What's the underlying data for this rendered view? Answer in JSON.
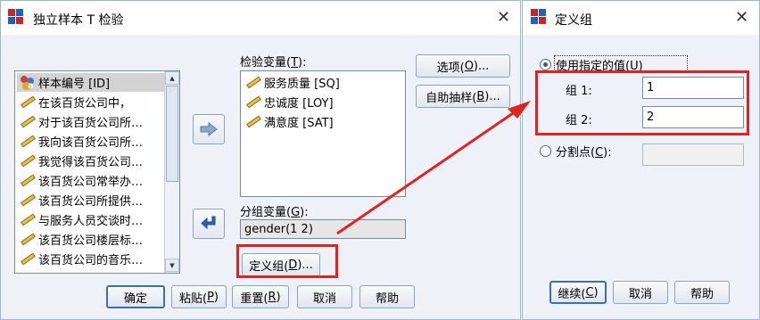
{
  "main_dialog": {
    "title": "独立样本 T 检验",
    "variables": [
      {
        "label": "样本编号 [ID]",
        "icon": "nominal-icon",
        "selected": true
      },
      {
        "label": "在该百货公司中，",
        "icon": "scale-ruler-icon"
      },
      {
        "label": "对于该百货公司所…",
        "icon": "scale-ruler-icon"
      },
      {
        "label": "我向该百货公司所…",
        "icon": "scale-ruler-icon"
      },
      {
        "label": "我觉得该百货公司…",
        "icon": "scale-ruler-icon"
      },
      {
        "label": "该百货公司常举办…",
        "icon": "scale-ruler-icon"
      },
      {
        "label": "该百货公司所提供…",
        "icon": "scale-ruler-icon"
      },
      {
        "label": "与服务人员交谈时…",
        "icon": "scale-ruler-icon"
      },
      {
        "label": "该百货公司楼层标…",
        "icon": "scale-ruler-icon"
      },
      {
        "label": "该百货公司的音乐…",
        "icon": "scale-ruler-icon"
      }
    ],
    "test_variable_label_prefix": "检验变量(",
    "test_variable_label_key": "T",
    "test_variable_label_suffix": "):",
    "test_variables": [
      {
        "label": "服务质量 [SQ]"
      },
      {
        "label": "忠诚度 [LOY]"
      },
      {
        "label": "满意度 [SAT]"
      }
    ],
    "grouping_label_prefix": "分组变量(",
    "grouping_label_key": "G",
    "grouping_label_suffix": "):",
    "grouping_value": "gender(1 2)",
    "define_groups_button": {
      "prefix": "定义组(",
      "key": "D",
      "suffix": ")..."
    },
    "options_button": {
      "prefix": "选项(",
      "key": "O",
      "suffix": ")..."
    },
    "bootstrap_button": {
      "prefix": "自助抽样(",
      "key": "B",
      "suffix": ")..."
    },
    "bottom_buttons": {
      "ok": "确定",
      "paste": {
        "prefix": "粘贴(",
        "key": "P",
        "suffix": ")"
      },
      "reset": {
        "prefix": "重置(",
        "key": "R",
        "suffix": ")"
      },
      "cancel": "取消",
      "help": "帮助"
    }
  },
  "define_dialog": {
    "title": "定义组",
    "use_specified_prefix": "使用指定的值(",
    "use_specified_key": "U",
    "use_specified_suffix": ")",
    "use_specified_checked": true,
    "group1_label": "组 1:",
    "group1_value": "1",
    "group2_label": "组 2:",
    "group2_value": "2",
    "cutpoint_prefix": "分割点(",
    "cutpoint_key": "C",
    "cutpoint_suffix": "):",
    "cutpoint_checked": false,
    "cutpoint_value": "",
    "continue": {
      "prefix": "继续(",
      "key": "C",
      "suffix": ")"
    },
    "cancel": "取消",
    "help": "帮助"
  },
  "colors": {
    "highlight_red": "#e02222",
    "dialog_bg": "#eef2f8",
    "selection_gray": "#d3d3d3",
    "radio_blue": "#1f5ea8"
  }
}
